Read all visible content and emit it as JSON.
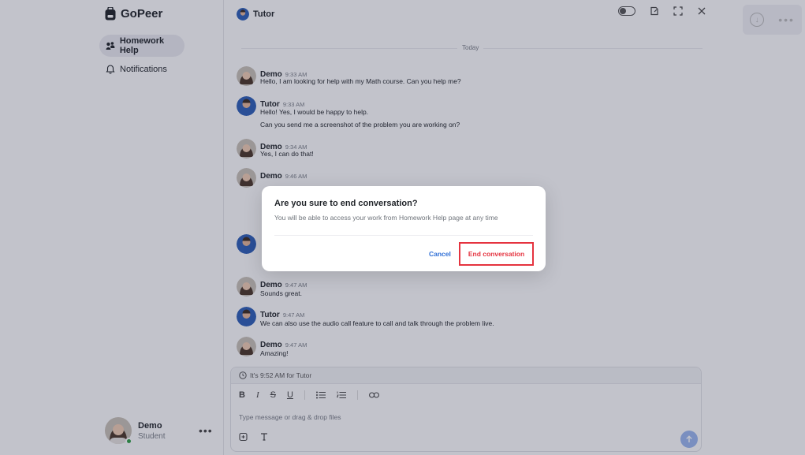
{
  "brand": {
    "name": "GoPeer"
  },
  "sidebar": {
    "items": [
      {
        "label": "Homework Help",
        "icon": "homework-icon",
        "active": true
      },
      {
        "label": "Notifications",
        "icon": "bell-icon",
        "active": false
      }
    ],
    "user": {
      "name": "Demo",
      "role": "Student"
    },
    "more_label": "•••"
  },
  "header": {
    "title": "Tutor"
  },
  "chat": {
    "date_label": "Today",
    "messages": [
      {
        "name": "Demo",
        "time": "9:33 AM",
        "lines": [
          "Hello, I am looking for help with my Math course. Can you help me?"
        ]
      },
      {
        "name": "Tutor",
        "time": "9:33 AM",
        "lines": [
          "Hello! Yes, I would be happy to help.",
          "Can you send me a screenshot of the problem you are working on?"
        ]
      },
      {
        "name": "Demo",
        "time": "9:34 AM",
        "lines": [
          "Yes, I can do that!"
        ]
      },
      {
        "name": "Demo",
        "time": "9:46 AM",
        "lines": []
      },
      {
        "name": "Demo",
        "time": "9:47 AM",
        "lines": [
          "Sounds great."
        ]
      },
      {
        "name": "Tutor",
        "time": "9:47 AM",
        "lines": [
          "We can also use the audio call feature to call and talk through the problem live."
        ]
      },
      {
        "name": "Demo",
        "time": "9:47 AM",
        "lines": [
          "Amazing!"
        ]
      }
    ]
  },
  "composer": {
    "tutor_time_notice": "It's 9:52 AM for Tutor",
    "placeholder": "Type message or drag & drop files",
    "format_buttons": {
      "bold": "B",
      "italic": "I",
      "strike": "S",
      "underline": "U"
    }
  },
  "modal": {
    "title": "Are you sure to end conversation?",
    "subtitle": "You will be able to access your work from Homework Help page at any time",
    "cancel_label": "Cancel",
    "confirm_label": "End conversation"
  },
  "colors": {
    "accent": "#2f6fd6",
    "danger": "#e5333f",
    "online": "#2ea043"
  }
}
